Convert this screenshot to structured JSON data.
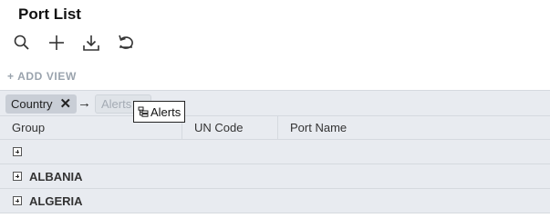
{
  "page": {
    "title": "Port List"
  },
  "toolbar": {
    "icons": [
      "search-icon",
      "plus-icon",
      "download-icon",
      "undo-icon"
    ]
  },
  "add_view": {
    "label": "+ ADD VIEW"
  },
  "grouping": {
    "chips": [
      {
        "label": "Country",
        "removable": true
      },
      {
        "label": "Alerts",
        "dragging": true
      }
    ],
    "arrow": "→"
  },
  "drag_tooltip": {
    "label": "Alerts"
  },
  "table": {
    "columns": [
      "Group",
      "UN Code",
      "Port Name"
    ],
    "rows": [
      {
        "group": ""
      },
      {
        "group": "ALBANIA"
      },
      {
        "group": "ALGERIA"
      }
    ]
  }
}
